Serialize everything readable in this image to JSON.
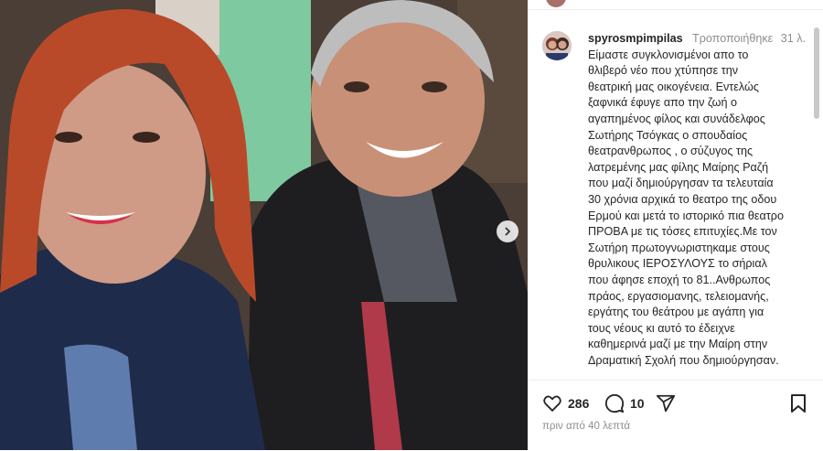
{
  "post": {
    "photo": {
      "alt_icon": "photo-two-people"
    }
  },
  "comment": {
    "username": "spyrosmpimpilas",
    "edited": "Τροποποιήθηκε",
    "time": "31 λ.",
    "text": "Είμαστε συγκλονισμένοι απο το\nθλιβερό νέο που χτύπησε την\nθεατρική μας οικογένεια.  Εντελώς\nξαφνικά έφυγε απο την ζωή ο\nαγαπημένος φίλος και συνάδελφος\nΣωτήρης Τσόγκας ο σπουδαίος\nθεατρανθρωπος , ο σύζυγος της\nλατρεμένης μας φίλης Μαίρης Ραζή\nπου μαζί δημιούργησαν τα τελευταία\n30 χρόνια αρχικά το θεατρο της οδου\nΕρμού και μετά το ιστορικό πια θεατρο\nΠΡΟΒΑ με τις τόσες επιτυχίες.Με τον\nΣωτήρη πρωτογνωριστηκαμε στους\nθρυλικους ΙΕΡΟΣΥΛΟΥΣ  το σήριαλ\nπου άφησε εποχή το 81..Ανθρωπος\nπράος, εργασιομανης, τελειομανής,\nεργάτης του θεάτρου με αγάπη για\nτους νέους  κι αυτό το έδειχνε\nκαθημερινά μαζί με την Μαίρη στην\nΔραματική Σχολή που δημιούργησαν."
  },
  "actions": {
    "likes": "286",
    "comments": "10",
    "ago": "πριν από 40 λεπτά"
  },
  "colors": {
    "text": "#262626",
    "muted": "#8e8e8e"
  }
}
